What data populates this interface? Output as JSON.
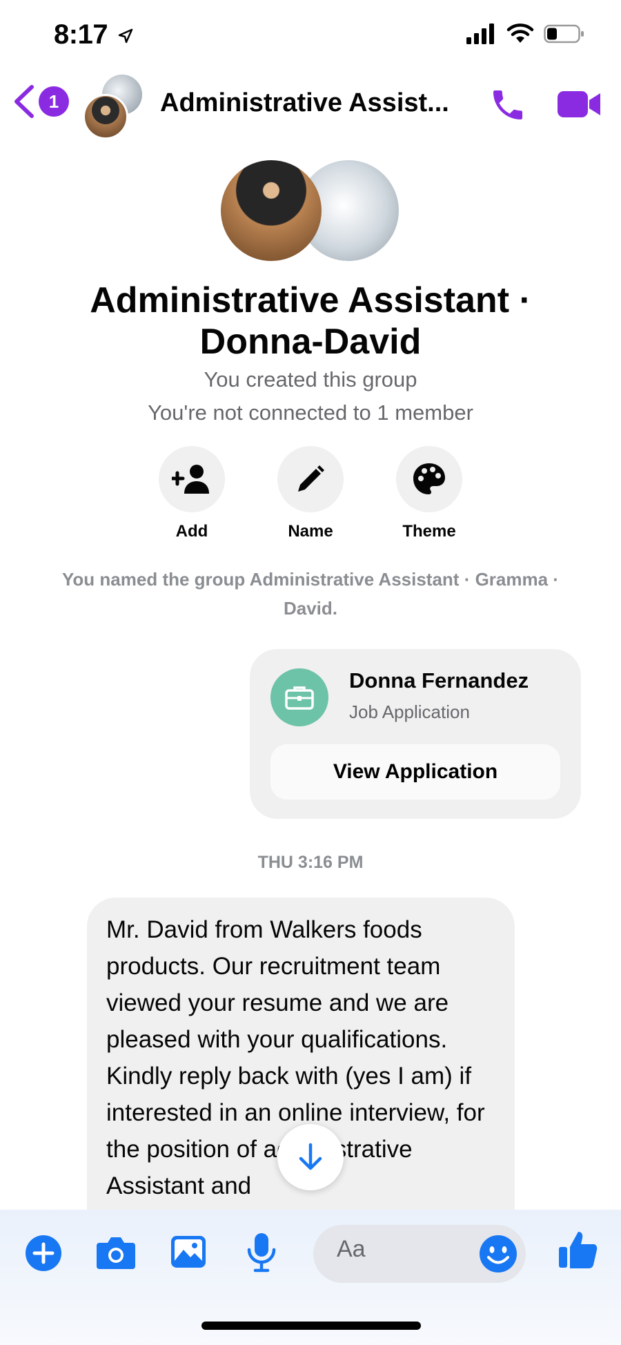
{
  "status_bar": {
    "time": "8:17"
  },
  "header": {
    "back_badge": "1",
    "title": "Administrative Assist..."
  },
  "group": {
    "title_line1": "Administrative Assistant ·",
    "title_line2": "Donna-David",
    "created": "You created this group",
    "connection": "You're not connected to 1 member"
  },
  "actions": [
    {
      "label": "Add",
      "icon": "add-person-icon"
    },
    {
      "label": "Name",
      "icon": "pencil-icon"
    },
    {
      "label": "Theme",
      "icon": "palette-icon"
    }
  ],
  "system_message": "You named the group Administrative Assistant · Gramma · David.",
  "application_card": {
    "name": "Donna Fernandez",
    "subtitle": "Job Application",
    "button": "View Application",
    "icon": "briefcase-icon"
  },
  "timestamp": "THU 3:16 PM",
  "message": {
    "text": "Mr. David from Walkers foods products. Our recruitment team viewed your resume and we are pleased with your qualifications. Kindly reply back with (yes I am) if interested in an online interview, for the position of administrative Assistant and"
  },
  "composer": {
    "placeholder": "Aa",
    "icons": [
      "plus-icon",
      "camera-icon",
      "gallery-icon",
      "microphone-icon",
      "emoji-icon",
      "like-icon"
    ]
  },
  "colors": {
    "accent": "#8a2be2",
    "composer_blue": "#1877f2",
    "card_icon": "#6dc3a7"
  }
}
